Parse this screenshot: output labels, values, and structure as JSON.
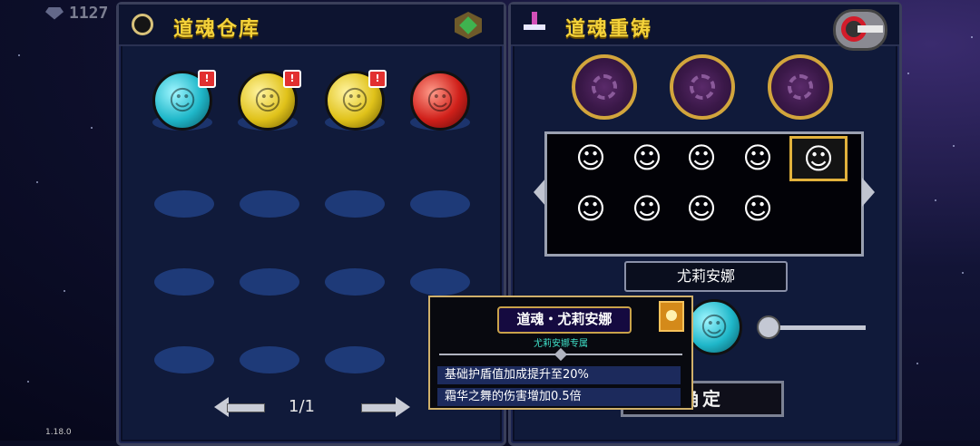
{
  "currency": {
    "amount": "1127"
  },
  "version": "1.18.0",
  "left_panel": {
    "title": "道魂仓库",
    "orbs": [
      {
        "color": "cyan",
        "alert": "!"
      },
      {
        "color": "yellow",
        "alert": "!"
      },
      {
        "color": "yellow",
        "alert": "!"
      },
      {
        "color": "red",
        "alert": ""
      }
    ],
    "empty_slots": 12,
    "page": "1/1"
  },
  "right_panel": {
    "title": "道魂重铸",
    "sockets": 3,
    "portraits_row1": 5,
    "portraits_row2": 4,
    "selected_portrait_index": 4,
    "selected_name": "尤莉安娜",
    "confirm_label": "确定"
  },
  "tooltip": {
    "title": "道魂・尤莉安娜",
    "subtitle": "尤莉安娜专属",
    "effects": [
      "基础护盾值加成提升至20%",
      "霜华之舞的伤害增加0.5倍"
    ]
  },
  "colors": {
    "title": "#f4d23a",
    "panel_bg": "#101a3a",
    "slot": "#1e3a78",
    "gold_border": "#d2a53c"
  }
}
